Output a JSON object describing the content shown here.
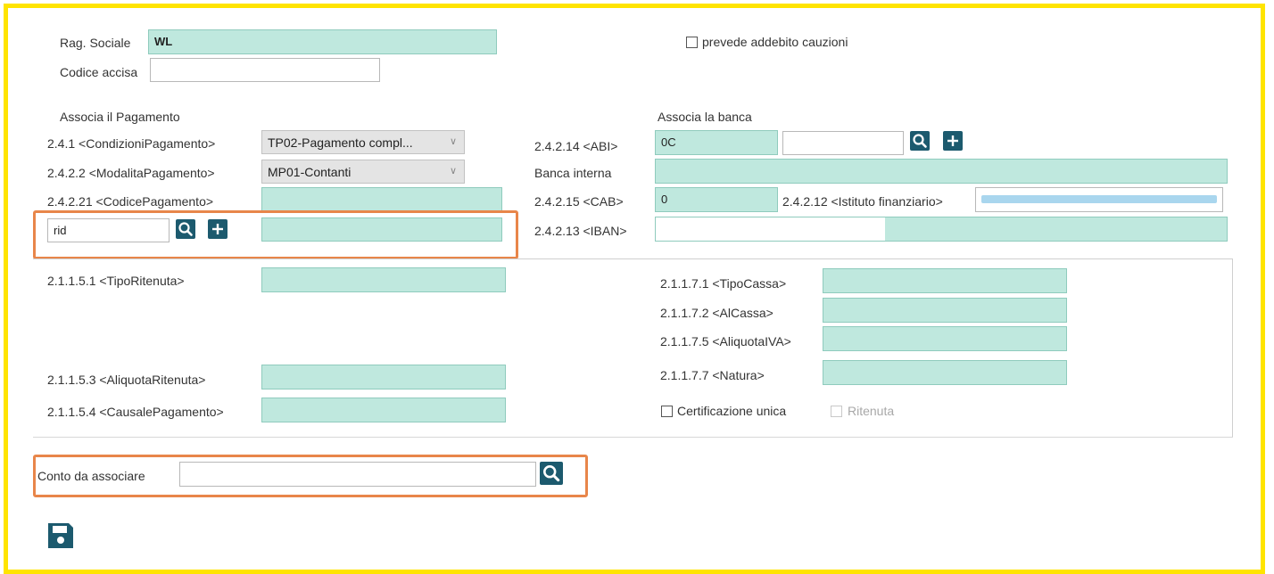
{
  "header": {
    "rag_sociale_label": "Rag. Sociale",
    "rag_sociale_value": "WL",
    "codice_accisa_label": "Codice accisa",
    "codice_accisa_value": "",
    "addebito_cauzioni_label": "prevede addebito cauzioni"
  },
  "pagamento": {
    "section_title": "Associa il Pagamento",
    "condizioni_label": "2.4.1  <CondizioniPagamento>",
    "condizioni_value": "TP02-Pagamento compl...",
    "modalita_label": "2.4.2.2  <ModalitaPagamento>",
    "modalita_value": "MP01-Contanti",
    "codice_label": "2.4.2.21  <CodicePagamento>",
    "codice_value": "",
    "search_value": "rid",
    "search_result": ""
  },
  "banca": {
    "section_title": "Associa la banca",
    "abi_label": "2.4.2.14  <ABI>",
    "abi_value": "0C",
    "abi_search": "",
    "interna_label": "Banca interna",
    "interna_value": "",
    "cab_label": "2.4.2.15  <CAB>",
    "cab_value": "0",
    "istituto_label": "2.4.2.12 <Istituto finanziario>",
    "iban_label": "2.4.2.13  <IBAN>",
    "iban_value": ""
  },
  "ritenuta": {
    "tipo_label": "2.1.1.5.1  <TipoRitenuta>",
    "tipo_value": "",
    "aliquota_label": "2.1.1.5.3  <AliquotaRitenuta>",
    "aliquota_value": "",
    "causale_label": "2.1.1.5.4 <CausalePagamento>",
    "causale_value": ""
  },
  "cassa": {
    "tipo_label": "2.1.1.7.1  <TipoCassa>",
    "al_label": "2.1.1.7.2  <AlCassa>",
    "aliquota_iva_label": "2.1.1.7.5  <AliquotaIVA>",
    "natura_label": "2.1.1.7.7  <Natura>",
    "certificazione_label": "Certificazione unica",
    "ritenuta_label": "Ritenuta"
  },
  "conto": {
    "label": "Conto da associare",
    "value": ""
  },
  "icons": {
    "search": "search-icon",
    "add": "plus-icon",
    "save": "save-icon",
    "dropdown": "chevron-down-icon"
  },
  "colors": {
    "frame": "#ffe400",
    "highlight": "#e8864a",
    "field": "#bfe8de",
    "button": "#1c5a6e"
  }
}
